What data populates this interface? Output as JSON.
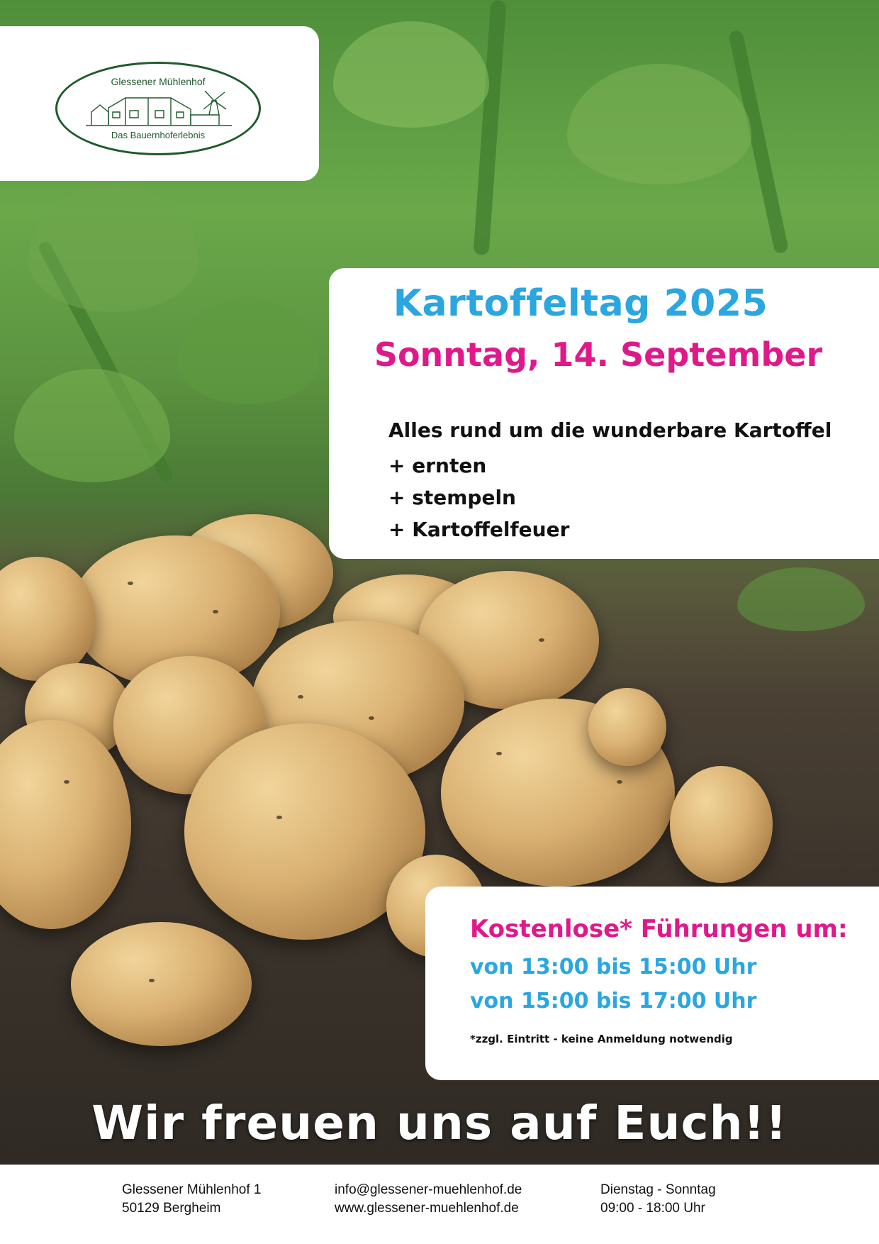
{
  "logo": {
    "name_top": "Glessener Mühlenhof",
    "name_bottom": "Das Bauernhoferlebnis"
  },
  "event": {
    "title": "Kartoffeltag 2025",
    "date": "Sonntag, 14. September",
    "subline": "Alles rund um die wunderbare Kartoffel",
    "activities": [
      "+ ernten",
      "+ stempeln",
      "+ Kartoffelfeuer"
    ]
  },
  "tours": {
    "heading": "Kostenlose* Führungen um:",
    "times": [
      "von 13:00 bis 15:00 Uhr",
      "von 15:00 bis 17:00 Uhr"
    ],
    "note": "*zzgl. Eintritt - keine Anmeldung notwendig"
  },
  "slogan": "Wir freuen uns auf Euch!!",
  "footer": {
    "address": [
      "Glessener Mühlenhof 1",
      "50129 Bergheim"
    ],
    "contact": [
      "info@glessener-muehlenhof.de",
      "www.glessener-muehlenhof.de"
    ],
    "hours": [
      "Dienstag - Sonntag",
      "09:00 - 18:00 Uhr"
    ]
  },
  "colors": {
    "title_blue": "#2aa6e0",
    "accent_magenta": "#e0198a",
    "logo_green": "#1f5a2c"
  }
}
